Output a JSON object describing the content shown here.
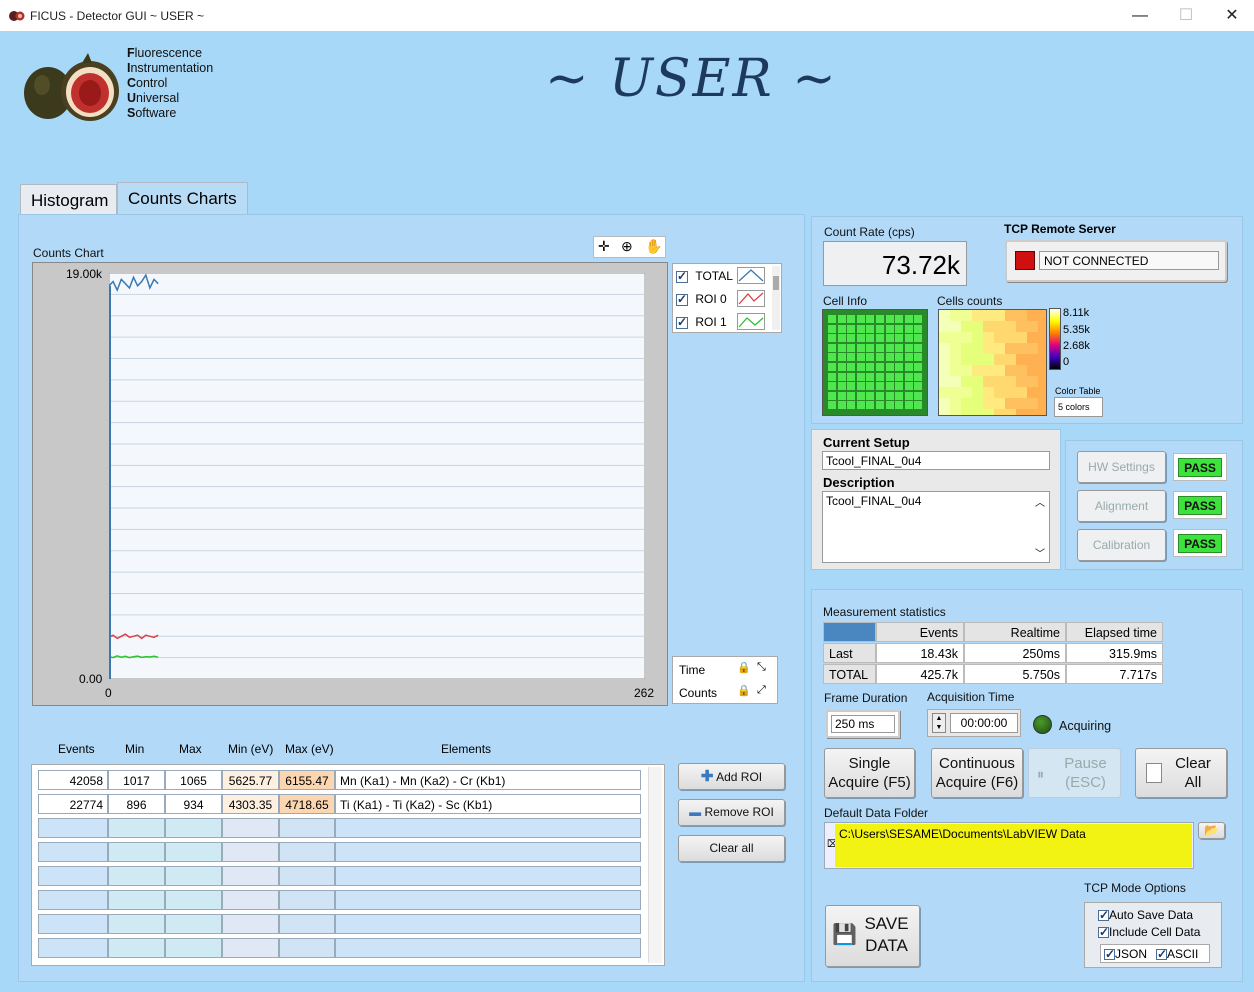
{
  "window": {
    "title": "FICUS - Detector GUI ~ USER ~"
  },
  "header": {
    "acronym": [
      {
        "initial": "F",
        "rest": "luorescence"
      },
      {
        "initial": "I",
        "rest": "nstrumentation"
      },
      {
        "initial": "C",
        "rest": "ontrol"
      },
      {
        "initial": "U",
        "rest": "niversal"
      },
      {
        "initial": "S",
        "rest": "oftware"
      }
    ],
    "mode_title": "~ USER ~"
  },
  "tabs": [
    {
      "label": "Histogram"
    },
    {
      "label": "Counts Charts"
    }
  ],
  "chart": {
    "label": "Counts Chart",
    "y_max_label": "19.00k",
    "y_min_label": "0.00",
    "x_min_label": "0",
    "x_max_label": "262",
    "legend": [
      {
        "name": "TOTAL",
        "color": "#3a78b0"
      },
      {
        "name": "ROI 0",
        "color": "#e04040"
      },
      {
        "name": "ROI 1",
        "color": "#30c030"
      }
    ],
    "scale_labels": {
      "x": "Time",
      "y": "Counts"
    }
  },
  "chart_data": {
    "type": "line",
    "title": "Counts Chart",
    "xlabel": "Time",
    "ylabel": "Counts",
    "xlim": [
      0,
      262
    ],
    "ylim": [
      0,
      19000
    ],
    "series": [
      {
        "name": "TOTAL",
        "x": [
          0,
          2,
          4,
          6,
          8,
          10,
          12,
          14,
          16,
          18,
          20,
          22,
          24
        ],
        "values": [
          18400,
          18600,
          18200,
          18700,
          18500,
          18300,
          18800,
          18400,
          18600,
          18900,
          18300,
          18700,
          18500
        ]
      },
      {
        "name": "ROI 0",
        "x": [
          0,
          2,
          4,
          6,
          8,
          10,
          12,
          14,
          16,
          18,
          20,
          22,
          24
        ],
        "values": [
          1950,
          2050,
          1900,
          2000,
          2100,
          1950,
          2000,
          2050,
          1900,
          2050,
          2000,
          1950,
          2050
        ]
      },
      {
        "name": "ROI 1",
        "x": [
          0,
          2,
          4,
          6,
          8,
          10,
          12,
          14,
          16,
          18,
          20,
          22,
          24
        ],
        "values": [
          1050,
          1000,
          1080,
          1020,
          1060,
          1000,
          1040,
          1070,
          1010,
          1050,
          1030,
          1060,
          1020
        ]
      }
    ]
  },
  "roi": {
    "headers": [
      "Events",
      "Min",
      "Max",
      "Min (eV)",
      "Max (eV)",
      "Elements"
    ],
    "rows": [
      {
        "events": "42058",
        "min": "1017",
        "max": "1065",
        "min_ev": "5625.77",
        "max_ev": "6155.47",
        "elements": "Mn (Ka1) - Mn (Ka2) - Cr (Kb1)"
      },
      {
        "events": "22774",
        "min": "896",
        "max": "934",
        "min_ev": "4303.35",
        "max_ev": "4718.65",
        "elements": "Ti (Ka1) - Ti (Ka2) - Sc (Kb1)"
      }
    ],
    "buttons": {
      "add": "Add ROI",
      "remove": "Remove ROI",
      "clear": "Clear all"
    }
  },
  "status": {
    "count_rate_label": "Count Rate (cps)",
    "count_rate": "73.72k",
    "tcp_label": "TCP Remote Server",
    "tcp_status": "NOT CONNECTED",
    "cell_info_label": "Cell Info",
    "cells_counts_label": "Cells counts",
    "color_scale": [
      "8.11k",
      "5.35k",
      "2.68k",
      "0"
    ],
    "color_table_label": "Color Table",
    "color_table_value": "5 colors"
  },
  "setup": {
    "current_setup_label": "Current Setup",
    "current_setup": "Tcool_FINAL_0u4",
    "description_label": "Description",
    "description": "Tcool_FINAL_0u4",
    "checks": [
      {
        "label": "HW Settings",
        "result": "PASS"
      },
      {
        "label": "Alignment",
        "result": "PASS"
      },
      {
        "label": "Calibration",
        "result": "PASS"
      }
    ]
  },
  "measurement": {
    "label": "Measurement statistics",
    "columns": [
      "Events",
      "Realtime",
      "Elapsed time"
    ],
    "rows": [
      {
        "name": "Last",
        "events": "18.43k",
        "realtime": "250ms",
        "elapsed": "315.9ms"
      },
      {
        "name": "TOTAL",
        "events": "425.7k",
        "realtime": "5.750s",
        "elapsed": "7.717s"
      }
    ],
    "frame_duration_label": "Frame Duration",
    "frame_duration": "250 ms",
    "acq_time_label": "Acquisition Time",
    "acq_time": "00:00:00",
    "acquiring_label": "Acquiring",
    "single_acquire": [
      "Single",
      "Acquire (F5)"
    ],
    "continuous_acquire": [
      "Continuous",
      "Acquire (F6)"
    ],
    "pause": [
      "Pause",
      "(ESC)"
    ],
    "clear_all": [
      "Clear",
      "All"
    ],
    "default_folder_label": "Default Data Folder",
    "default_folder": "C:\\Users\\SESAME\\Documents\\LabVIEW Data",
    "save_data": [
      "SAVE",
      "DATA"
    ],
    "tcp_mode_label": "TCP Mode Options",
    "auto_save": "Auto Save Data",
    "include_cell": "Include Cell Data",
    "json": "JSON",
    "ascii": "ASCII"
  }
}
